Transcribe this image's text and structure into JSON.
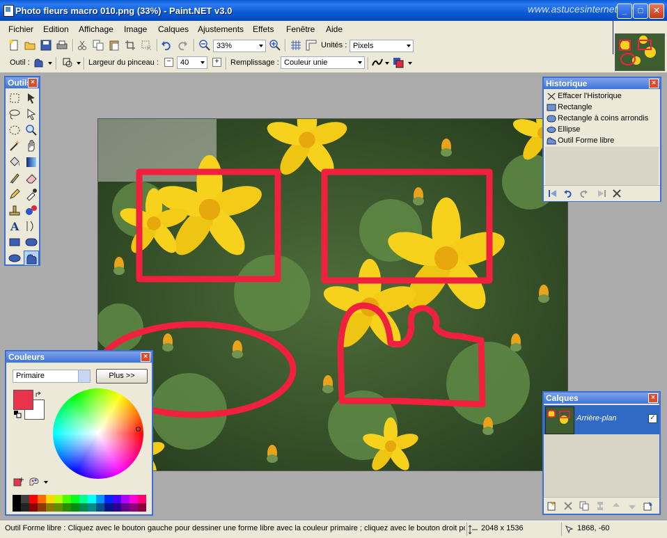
{
  "window": {
    "title": "Photo fleurs macro 010.png (33%) - Paint.NET v3.0",
    "watermark": "www.astucesinternet.com",
    "buttons": {
      "minimize": "_",
      "maximize": "□",
      "close": "✕"
    }
  },
  "menu": {
    "items": [
      "Fichier",
      "Edition",
      "Affichage",
      "Image",
      "Calques",
      "Ajustements",
      "Effets",
      "Fenêtre",
      "Aide"
    ]
  },
  "toolbar": {
    "zoom_value": "33%",
    "units_label": "Unités :",
    "units_value": "Pixels"
  },
  "tool_options": {
    "tool_label": "Outil :",
    "brush_width_label": "Largeur du pinceau :",
    "brush_width_value": "40",
    "fill_label": "Remplissage :",
    "fill_value": "Couleur unie"
  },
  "tools_panel": {
    "title": "Outils"
  },
  "history_panel": {
    "title": "Historique",
    "items": [
      {
        "label": "Effacer l'Historique",
        "icon": "clear-history-icon"
      },
      {
        "label": "Rectangle",
        "icon": "rectangle-icon"
      },
      {
        "label": "Rectangle à coins arrondis",
        "icon": "rounded-rectangle-icon"
      },
      {
        "label": "Ellipse",
        "icon": "ellipse-icon"
      },
      {
        "label": "Outil Forme libre",
        "icon": "freeform-shape-icon"
      }
    ]
  },
  "colors_panel": {
    "title": "Couleurs",
    "mode_value": "Primaire",
    "more_button": "Plus >>",
    "primary_color": "#e8334a",
    "secondary_color": "#ffffff",
    "palette": [
      "#000000",
      "#404040",
      "#ff0000",
      "#ff6a00",
      "#ffd800",
      "#b6ff00",
      "#4cff00",
      "#00ff21",
      "#00ff90",
      "#00ffff",
      "#0094ff",
      "#0026ff",
      "#4800ff",
      "#b200ff",
      "#ff00dc",
      "#ff006e"
    ]
  },
  "layers_panel": {
    "title": "Calques",
    "layer_name": "Arrière-plan"
  },
  "status": {
    "hint": "Outil Forme libre : Cliquez avec le bouton gauche pour dessiner une forme libre avec la couleur primaire ; cliquez avec le bouton droit pour",
    "image_size": "2048 x 1536",
    "cursor_position": "1868, -60"
  },
  "colors": {
    "title_bar": "#0a5bd8",
    "panel_border": "#3a6fd6",
    "chrome": "#ece9d8",
    "workspace": "#ababab",
    "annotation_red": "#f0213f",
    "flower_yellow": "#f7d21c",
    "foliage_green": "#3d5c2f"
  }
}
